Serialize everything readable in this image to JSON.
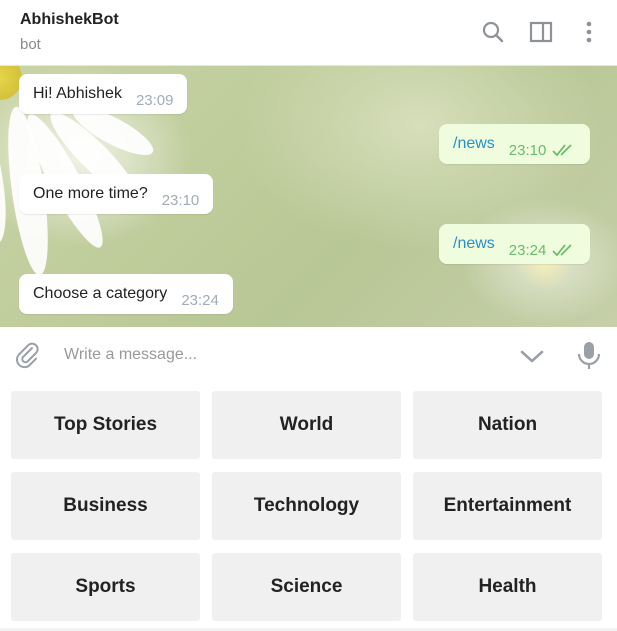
{
  "header": {
    "title": "AbhishekBot",
    "subtitle": "bot"
  },
  "icons": {
    "search": "search-icon",
    "panel": "side-panel-icon",
    "more": "more-vertical-icon",
    "attach": "paperclip-icon",
    "scroll": "chevron-down-icon",
    "mic": "microphone-icon",
    "read": "double-check-icon"
  },
  "messages": [
    {
      "direction": "in",
      "text": "Hi! Abhishek",
      "time": "23:09"
    },
    {
      "direction": "out",
      "text": "/news",
      "time": "23:10"
    },
    {
      "direction": "in",
      "text": "One more time?",
      "time": "23:10"
    },
    {
      "direction": "out",
      "text": "/news",
      "time": "23:24"
    },
    {
      "direction": "in",
      "text": "Choose a category",
      "time": "23:24"
    }
  ],
  "composer": {
    "placeholder": "Write a message..."
  },
  "keyboard": {
    "buttons": [
      "Top Stories",
      "World",
      "Nation",
      "Business",
      "Technology",
      "Entertainment",
      "Sports",
      "Science",
      "Health"
    ]
  },
  "colors": {
    "outgoing_bubble": "#effdde",
    "incoming_bubble": "#ffffff",
    "command_link": "#2a8fc7",
    "read_check": "#6cbb6c",
    "keyboard_button": "#f0f0f0"
  }
}
